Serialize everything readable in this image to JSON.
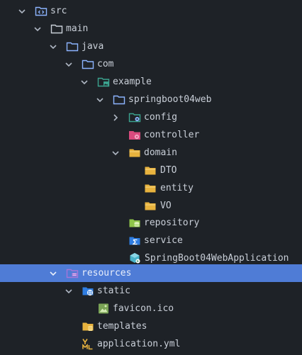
{
  "tree": {
    "src": "src",
    "main": "main",
    "java": "java",
    "com": "com",
    "example": "example",
    "springboot04web": "springboot04web",
    "config": "config",
    "controller": "controller",
    "domain": "domain",
    "dto": "DTO",
    "entity": "entity",
    "vo": "VO",
    "repository": "repository",
    "service": "service",
    "application_class": "SpringBoot04WebApplication",
    "resources": "resources",
    "static": "static",
    "favicon": "favicon.ico",
    "templates": "templates",
    "application_yml": "application.yml"
  },
  "colors": {
    "background": "#1e2227",
    "selection": "#4f7cd6",
    "folder_outline": "#8cb4ff",
    "yellow_folder": "#e8b33e",
    "teal": "#3ba38f",
    "controller_pink": "#d94a7e",
    "resource_purple": "#a676d8",
    "repository_green": "#8ec449"
  }
}
